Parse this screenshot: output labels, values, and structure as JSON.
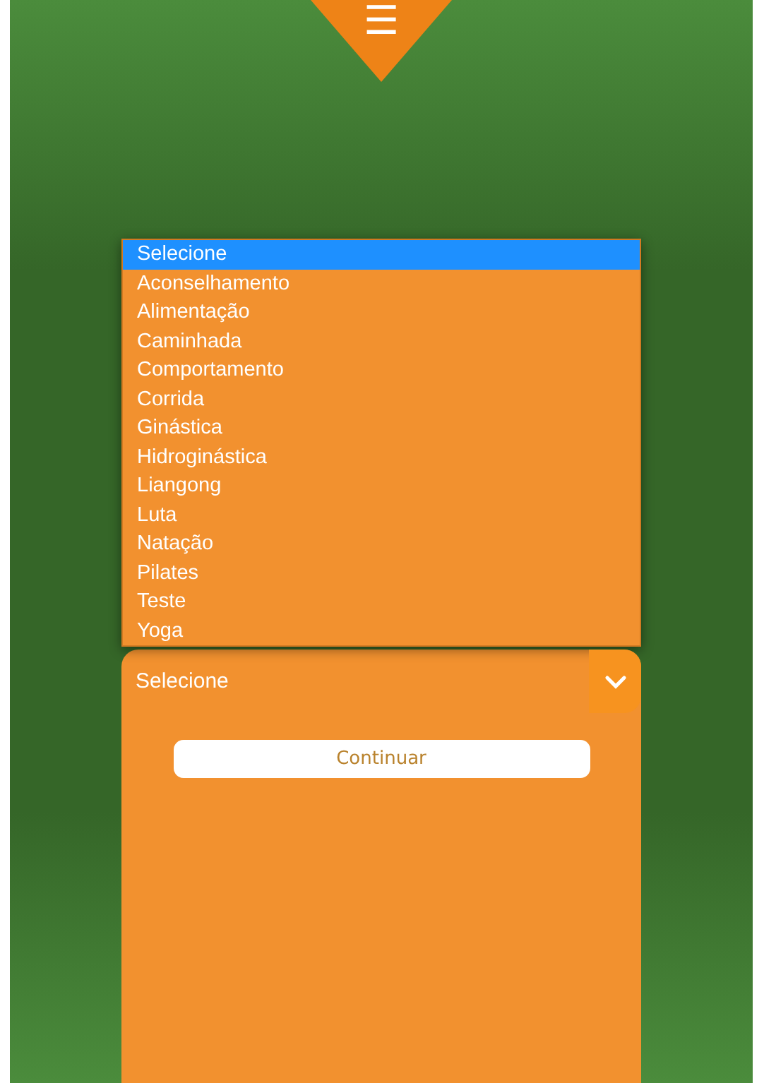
{
  "menu_button": {
    "label": "☰"
  },
  "select": {
    "value": "Selecione",
    "expanded": true,
    "options": [
      {
        "label": "Selecione",
        "selected": true
      },
      {
        "label": "Aconselhamento",
        "selected": false
      },
      {
        "label": "Alimentação",
        "selected": false
      },
      {
        "label": "Caminhada",
        "selected": false
      },
      {
        "label": "Comportamento",
        "selected": false
      },
      {
        "label": "Corrida",
        "selected": false
      },
      {
        "label": "Ginástica",
        "selected": false
      },
      {
        "label": "Hidroginástica",
        "selected": false
      },
      {
        "label": "Liangong",
        "selected": false
      },
      {
        "label": "Luta",
        "selected": false
      },
      {
        "label": "Natação",
        "selected": false
      },
      {
        "label": "Pilates",
        "selected": false
      },
      {
        "label": "Teste",
        "selected": false
      },
      {
        "label": "Yoga",
        "selected": false
      }
    ]
  },
  "continue_button": {
    "label": "Continuar"
  }
}
